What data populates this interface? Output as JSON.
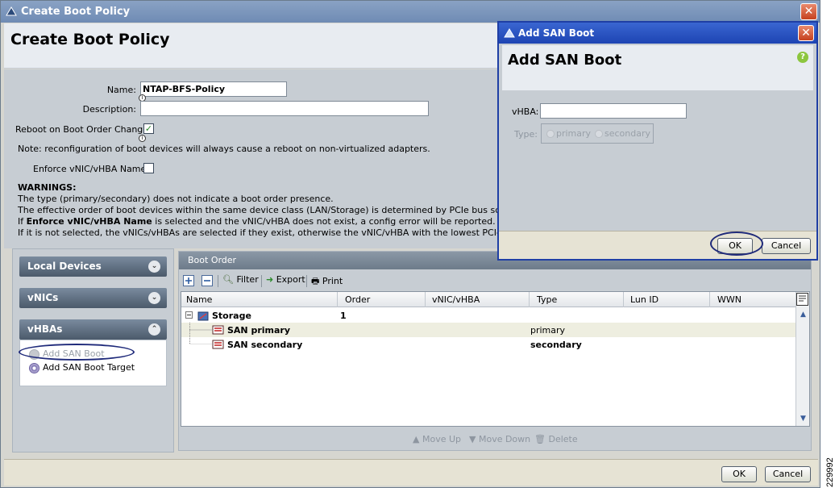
{
  "window": {
    "title": "Create Boot Policy",
    "header": "Create Boot Policy"
  },
  "form": {
    "name_label": "Name:",
    "name_value": "NTAP-BFS-Policy",
    "description_label": "Description:",
    "description_value": "",
    "reboot_label": "Reboot on Boot Order Change:",
    "reboot_checked": true,
    "note": "Note: reconfiguration of boot devices will always cause a reboot on non-virtualized adapters.",
    "enforce_label": "Enforce vNIC/vHBA Name:",
    "enforce_checked": false,
    "warnings_title": "WARNINGS:",
    "warning_1": "The type (primary/secondary) does not indicate a boot order presence.",
    "warning_2": "The effective order of boot devices within the same device class (LAN/Storage) is determined by PCIe bus scan order.",
    "warning_3_prefix": "If ",
    "warning_3_bold": "Enforce vNIC/vHBA Name",
    "warning_3_suffix": " is selected and the vNIC/vHBA does not exist, a config error will be reported.",
    "warning_4": "If it is not selected, the vNICs/vHBAs are selected if they exist, otherwise the vNIC/vHBA with the lowest PCIe bus scan order is used."
  },
  "left_panel": {
    "sections": [
      {
        "label": "Local Devices",
        "expanded": false
      },
      {
        "label": "vNICs",
        "expanded": false
      },
      {
        "label": "vHBAs",
        "expanded": true
      }
    ],
    "vhba_items": [
      {
        "label": "Add SAN Boot",
        "disabled": true
      },
      {
        "label": "Add SAN Boot Target",
        "disabled": false
      }
    ]
  },
  "boot_order": {
    "title": "Boot Order",
    "toolbar": {
      "filter": "Filter",
      "export": "Export",
      "print": "Print"
    },
    "columns": [
      "Name",
      "Order",
      "vNIC/vHBA",
      "Type",
      "Lun ID",
      "WWN"
    ],
    "rows": [
      {
        "name": "Storage",
        "order": "1",
        "vnic": "",
        "type": "",
        "lun": "",
        "wwn": "",
        "level": 0
      },
      {
        "name": "SAN primary",
        "order": "",
        "vnic": "",
        "type": "primary",
        "lun": "",
        "wwn": "",
        "level": 1
      },
      {
        "name": "SAN secondary",
        "order": "",
        "vnic": "",
        "type": "secondary",
        "lun": "",
        "wwn": "",
        "level": 1
      }
    ],
    "actions": {
      "move_up": "Move Up",
      "move_down": "Move Down",
      "delete": "Delete"
    }
  },
  "footer": {
    "ok": "OK",
    "cancel": "Cancel"
  },
  "dialog": {
    "title": "Add SAN Boot",
    "header": "Add SAN Boot",
    "vhba_label": "vHBA:",
    "vhba_value": "",
    "type_label": "Type:",
    "type_options": [
      "primary",
      "secondary"
    ],
    "ok": "OK",
    "cancel": "Cancel"
  },
  "figure_id": "229992",
  "colors": {
    "titlebar": "#7a95bd",
    "dialog_titlebar": "#2b55c4",
    "accordion": "#5c6b7c",
    "highlight_oval": "#1f2a7a"
  }
}
